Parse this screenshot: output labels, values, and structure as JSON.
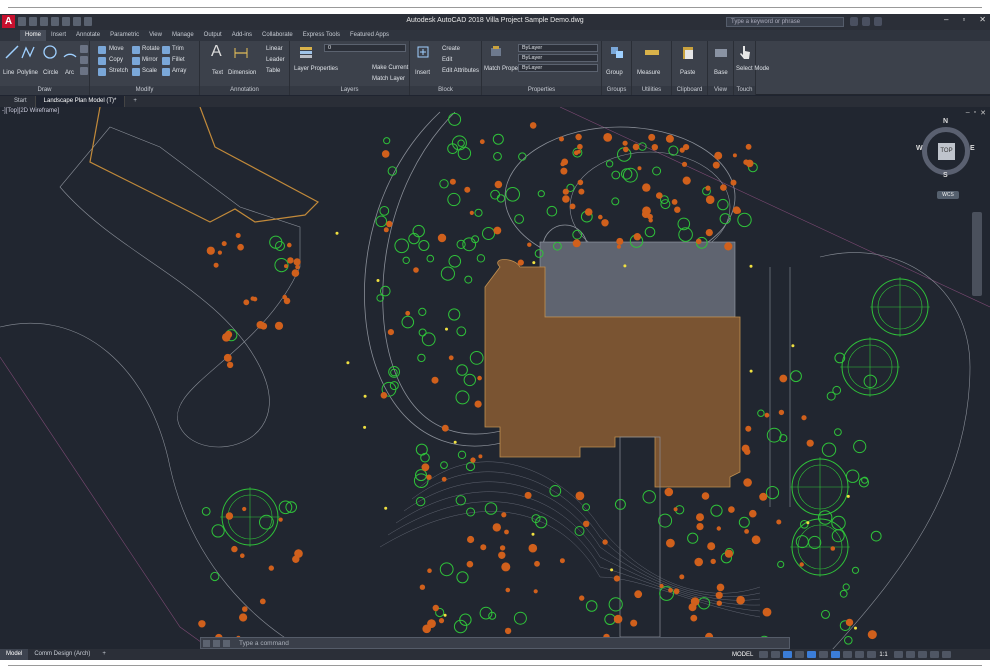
{
  "app": {
    "title": "Autodesk AutoCAD 2018   Villa Project Sample Demo.dwg",
    "logo": "A",
    "search_placeholder": "Type a keyword or phrase"
  },
  "ribbon_tabs": [
    "Home",
    "Insert",
    "Annotate",
    "Parametric",
    "View",
    "Manage",
    "Output",
    "Add-ins",
    "Collaborate",
    "Express Tools",
    "Featured Apps"
  ],
  "panels": {
    "draw": {
      "title": "Draw",
      "items": [
        "Line",
        "Polyline",
        "Circle",
        "Arc"
      ]
    },
    "modify": {
      "title": "Modify",
      "items": [
        "Move",
        "Rotate",
        "Trim",
        "Copy",
        "Mirror",
        "Fillet",
        "Stretch",
        "Scale",
        "Array"
      ]
    },
    "annotation": {
      "title": "Annotation",
      "items": [
        "Text",
        "Dimension",
        "Linear",
        "Leader",
        "Table"
      ]
    },
    "layers": {
      "title": "Layers",
      "items": [
        "Layer Properties",
        "Make Current",
        "Match Layer"
      ],
      "current_layer": "0"
    },
    "block": {
      "title": "Block",
      "items": [
        "Insert",
        "Create",
        "Edit",
        "Edit Attributes"
      ]
    },
    "properties": {
      "title": "Properties",
      "items": [
        "Match Properties"
      ],
      "bylayer": [
        "ByLayer",
        "ByLayer",
        "ByLayer"
      ]
    },
    "groups": {
      "title": "Groups",
      "items": [
        "Group"
      ]
    },
    "utilities": {
      "title": "Utilities",
      "items": [
        "Measure"
      ]
    },
    "clipboard": {
      "title": "Clipboard",
      "items": [
        "Paste"
      ]
    },
    "view": {
      "title": "View",
      "items": [
        "Base"
      ]
    },
    "touch": {
      "title": "Touch",
      "items": [
        "Select Mode"
      ]
    }
  },
  "file_tabs": [
    "Start",
    "Landscape Plan Model (T)*"
  ],
  "viewport_label": "-][Top][2D Wireframe]",
  "viewcube": {
    "face": "TOP",
    "n": "N",
    "s": "S",
    "e": "E",
    "w": "W",
    "wcs": "WCS"
  },
  "command_placeholder": "Type a command",
  "status": {
    "tabs": [
      "Model",
      "Comm Design (Arch)"
    ],
    "mode": "MODEL",
    "scale": "1:1"
  },
  "colors": {
    "bg": "#212630",
    "building": "#7a5432",
    "plant_green": "#2fc23a",
    "plant_orange": "#d0601c",
    "lines": "#8a8f98"
  }
}
